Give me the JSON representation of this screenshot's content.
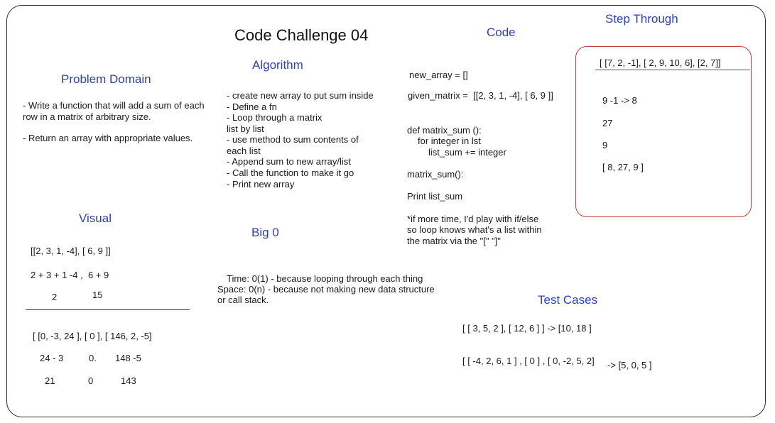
{
  "title": "Code Challenge 04",
  "problem_domain": {
    "heading": "Problem Domain",
    "lines": [
      "- Write a function that will add a sum of each",
      "row in a matrix of arbitrary size.",
      "- Return an array with appropriate values."
    ]
  },
  "algorithm": {
    "heading": "Algorithm",
    "lines": [
      "- create new array to put sum inside",
      "- Define a fn",
      "- Loop through a matrix",
      "list by list",
      "- use method to sum contents of",
      "each list",
      "- Append sum to new array/list",
      "- Call the function to make it go",
      "- Print new array"
    ]
  },
  "code": {
    "heading": "Code",
    "new_array": "new_array = []",
    "given_matrix": "given_matrix =  [[2, 3, 1, -4], [ 6, 9 ]]",
    "def_line": "def matrix_sum ():",
    "for_line": "for integer in lst",
    "sum_line": "list_sum += integer",
    "call_line": "matrix_sum():",
    "print_line": "Print list_sum",
    "note_lines": [
      "*if more time, I'd play with if/else",
      "so loop knows what's a list within",
      "the matrix via the \"[\" \"]\""
    ]
  },
  "step_through": {
    "heading": "Step Through",
    "input": "[ [7, 2, -1], [ 2, 9, 10, 6], [2, 7]]",
    "steps": [
      "9 -1 -> 8",
      "27",
      "9",
      "[ 8, 27, 9 ]"
    ]
  },
  "visual": {
    "heading": "Visual",
    "example1": {
      "matrix": "[[2, 3, 1, -4], [ 6, 9 ]]",
      "sums": "2 + 3 + 1 -4 ,  6 + 9",
      "result_a": "2",
      "result_b": "15"
    },
    "example2": {
      "matrix": "[ [0, -3, 24 ], [ 0 ], [ 146, 2, -5]",
      "work_a": "24 - 3",
      "work_b": "0.",
      "work_c": "148 -5",
      "result_a": "21",
      "result_b": "0",
      "result_c": "143"
    }
  },
  "big_o": {
    "heading": "Big 0",
    "lines": [
      "Time: 0(1) - because looping through each thing",
      "Space: 0(n) - because not making new data structure",
      "or call stack."
    ]
  },
  "test_cases": {
    "heading": "Test Cases",
    "case1": "[ [ 3, 5, 2 ], [ 12, 6 ] ] -> [10, 18 ]",
    "case2_input": "[ [ -4, 2, 6, 1 ] , [ 0 ] , [ 0, -2, 5, 2]",
    "case2_output": "-> [5, 0, 5 ]"
  },
  "colors": {
    "heading_blue": "#2b3fbd",
    "step_box_red": "#c93a3a",
    "border": "#2a2a2a"
  }
}
